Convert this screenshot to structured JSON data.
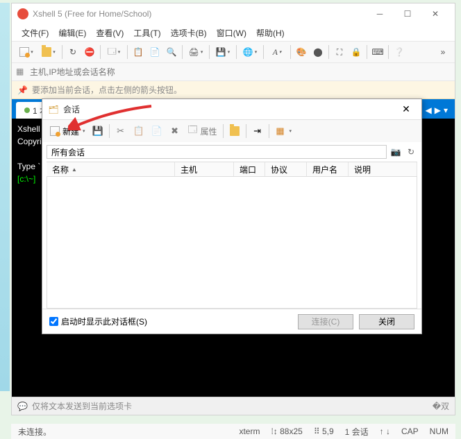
{
  "window": {
    "title": "Xshell 5 (Free for Home/School)"
  },
  "menu": {
    "file": "文件(F)",
    "edit": "编辑(E)",
    "view": "查看(V)",
    "tools": "工具(T)",
    "tabs": "选项卡(B)",
    "window": "窗口(W)",
    "help": "帮助(H)"
  },
  "addr": {
    "placeholder": "主机,IP地址或会话名称"
  },
  "hint": {
    "text": "要添加当前会话，点击左侧的箭头按钮。"
  },
  "tabbar": {
    "tab1": "1 本"
  },
  "terminal": {
    "line1": "Xshell",
    "line2": "Copyri",
    "line3": "Type `",
    "prompt": "[c:\\~]"
  },
  "bottom": {
    "text": "仅将文本发送到当前选项卡"
  },
  "status": {
    "conn": "未连接。",
    "term": "xterm",
    "size": "88x25",
    "pos": "5,9",
    "sessions": "1 会话",
    "cap": "CAP",
    "num": "NUM"
  },
  "dialog": {
    "title": "会话",
    "new": "新建",
    "props": "属性",
    "search": "所有会话",
    "cols": {
      "name": "名称",
      "host": "主机",
      "port": "端口",
      "proto": "协议",
      "user": "用户名",
      "desc": "说明"
    },
    "checkbox": "启动时显示此对话框(S)",
    "connect": "连接(C)",
    "close": "关闭"
  }
}
